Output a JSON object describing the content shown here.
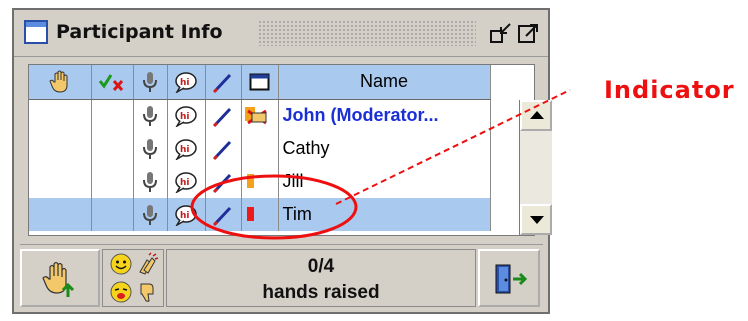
{
  "window": {
    "title": "Participant Info"
  },
  "table": {
    "headers": {
      "name": "Name"
    },
    "rows": [
      {
        "name": "John (Moderator...",
        "moderator": true,
        "selected": false
      },
      {
        "name": "Cathy",
        "moderator": false,
        "selected": false
      },
      {
        "name": "Jill",
        "moderator": false,
        "selected": false
      },
      {
        "name": "Tim",
        "moderator": false,
        "selected": true
      }
    ]
  },
  "status": {
    "count": "0/4",
    "label": "hands raised"
  },
  "annotation": {
    "label": "Indicator",
    "color": "#ee1010"
  },
  "colors": {
    "header_blue": "#a9c9ee",
    "moderator_text": "#1a2fd6",
    "indicator_orange": "#f5a11b",
    "indicator_red": "#ee1a1a"
  },
  "icons": {
    "title": "window-icon",
    "undock": "undock-icon",
    "maximize": "maximize-icon",
    "raise_hand": "raise-hand-icon",
    "approval": "check-cross-icon",
    "mic": "microphone-icon",
    "chat": "chat-bubble-icon",
    "pen": "pen-icon",
    "video": "video-window-icon",
    "exit": "exit-door-icon"
  }
}
